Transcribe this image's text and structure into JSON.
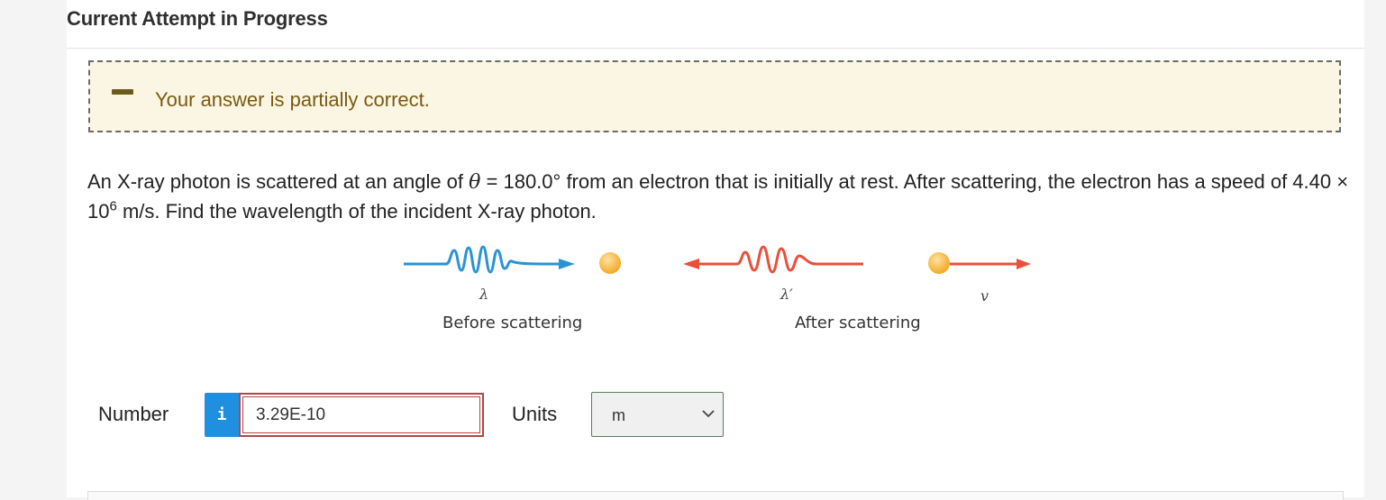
{
  "header": {
    "title": "Current Attempt in Progress"
  },
  "feedback": {
    "icon": "minus-partial-icon",
    "message": "Your answer is partially correct."
  },
  "question": {
    "text_before_theta": "An X-ray photon is scattered at an angle of ",
    "theta_symbol": "θ",
    "text_after_theta": " = 180.0° from an electron that is initially at rest. After scattering, the electron has a speed of 4.40 × 10",
    "exponent": "6",
    "text_end": " m/s. Find the wavelength of the incident X-ray photon."
  },
  "figure": {
    "before_caption": "Before scattering",
    "after_caption": "After scattering",
    "lambda_label": "λ",
    "lambda_prime_label": "λ′",
    "velocity_label": "v",
    "incoming_color": "#2a93d5",
    "outgoing_color": "#e8503a",
    "electron_color": "#f7b733"
  },
  "answer": {
    "number_label": "Number",
    "info_icon": "info-icon",
    "info_glyph": "i",
    "number_value": "3.29E-10",
    "units_label": "Units",
    "units_selected": "m"
  }
}
